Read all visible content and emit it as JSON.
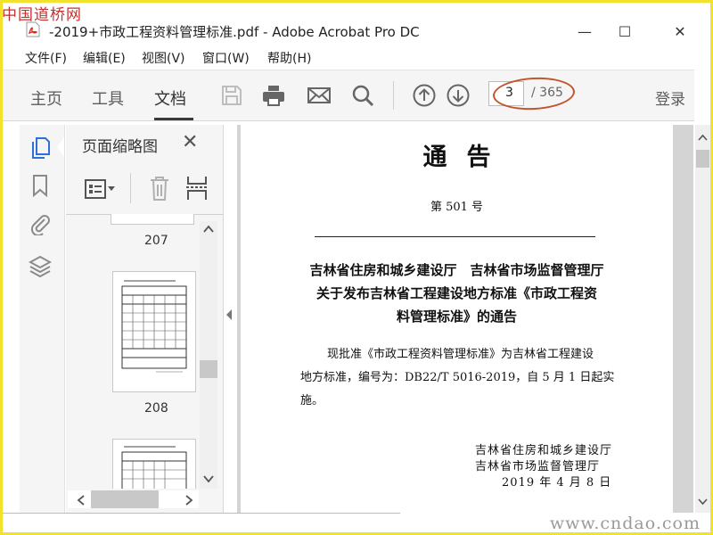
{
  "watermarks": {
    "top": "中国道桥网",
    "bottom": "www.cndao.com"
  },
  "window": {
    "title": "-2019+市政工程资料管理标准.pdf - Adobe Acrobat Pro DC",
    "app_icon": "acrobat-pdf-icon",
    "controls": {
      "minimize": "—",
      "maximize": "☐",
      "close": "✕"
    }
  },
  "menu": [
    "文件(F)",
    "编辑(E)",
    "视图(V)",
    "窗口(W)",
    "帮助(H)"
  ],
  "toolbar": {
    "tabs": [
      "主页",
      "工具",
      "文档"
    ],
    "active_tab": "文档",
    "icons": [
      "save-icon",
      "print-icon",
      "email-icon",
      "search-icon",
      "page-up-icon",
      "page-down-icon"
    ],
    "page_current": "3",
    "page_total": "/ 365",
    "login": "登录",
    "annotation_color": "#c0552e"
  },
  "left_rail": {
    "icons": [
      "page-thumbnails-icon",
      "bookmark-icon",
      "attachment-icon",
      "layers-icon"
    ],
    "accent": "#2f6fd8"
  },
  "thumbnail_panel": {
    "title": "页面缩略图",
    "close": "✕",
    "tool_icons": [
      "thumbnail-options-icon",
      "delete-page-icon",
      "extract-page-icon"
    ],
    "pages": [
      "207",
      "208"
    ]
  },
  "document": {
    "title": "通告",
    "number": "第 501 号",
    "heading": [
      "吉林省住房和城乡建设厅　吉林省市场监督管理厅",
      "关于发布吉林省工程建设地方标准《市政工程资",
      "料管理标准》的通告"
    ],
    "body": [
      "现批准《市政工程资料管理标准》为吉林省工程建设",
      "地方标准，编号为：DB22/T 5016-2019，自 5 月 1 日起实",
      "施。"
    ],
    "signature": [
      "吉林省住房和城乡建设厅",
      "吉林省市场监督管理厅",
      "2019 年 4 月 8 日"
    ]
  }
}
